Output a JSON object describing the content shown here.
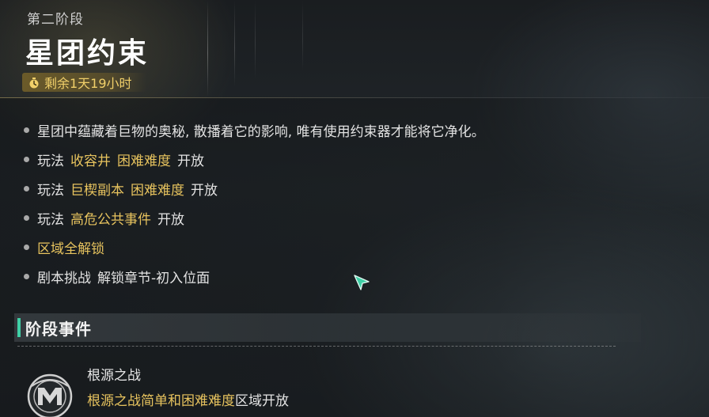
{
  "header": {
    "stage_label": "第二阶段",
    "title": "星团约束",
    "timer_icon": "stopwatch-icon",
    "timer_text": "剩余1天19小时"
  },
  "features": [
    {
      "parts": [
        {
          "text": "星团中蕴藏着巨物的奥秘, 散播着它的影响, 唯有使用约束器才能将它净化。",
          "color": "white"
        }
      ]
    },
    {
      "parts": [
        {
          "text": "玩法",
          "color": "white"
        },
        {
          "text": "收容井",
          "color": "gold"
        },
        {
          "text": "困难难度",
          "color": "gold"
        },
        {
          "text": "开放",
          "color": "white"
        }
      ]
    },
    {
      "parts": [
        {
          "text": "玩法",
          "color": "white"
        },
        {
          "text": "巨楔副本",
          "color": "gold"
        },
        {
          "text": "困难难度",
          "color": "gold"
        },
        {
          "text": "开放",
          "color": "white"
        }
      ]
    },
    {
      "parts": [
        {
          "text": "玩法",
          "color": "white"
        },
        {
          "text": "高危公共事件",
          "color": "gold"
        },
        {
          "text": "开放",
          "color": "white"
        }
      ]
    },
    {
      "parts": [
        {
          "text": "区域全解锁",
          "color": "gold"
        }
      ]
    },
    {
      "parts": [
        {
          "text": "剧本挑战",
          "color": "white"
        },
        {
          "text": "解锁章节-初入位面",
          "color": "white"
        }
      ]
    }
  ],
  "section": {
    "title": "阶段事件"
  },
  "event": {
    "icon": "event-emblem-icon",
    "title": "根源之战",
    "desc_highlight": "根源之战简单和困难难度",
    "desc_rest": "区域开放"
  },
  "colors": {
    "gold": "#e7c35e",
    "white": "#e3e3e3",
    "accent": "#3fd0a6"
  }
}
